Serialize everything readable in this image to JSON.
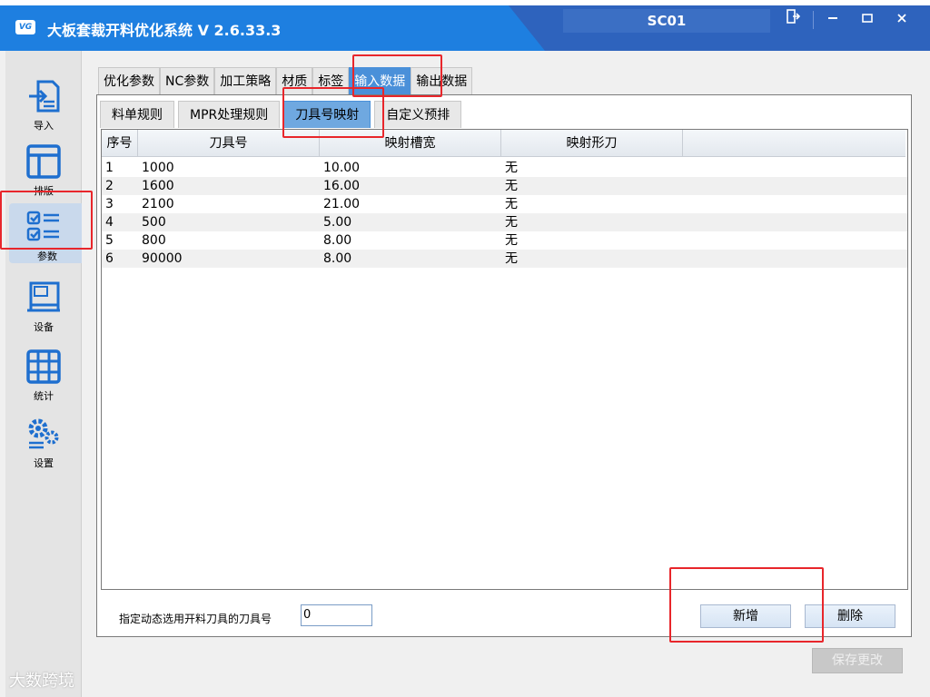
{
  "app": {
    "logo_text": "VG",
    "title": "大板套裁开料优化系统  V 2.6.33.3",
    "station": "SC01"
  },
  "sidebar": {
    "items": [
      {
        "label": "导入",
        "icon": "import-icon"
      },
      {
        "label": "排版",
        "icon": "layout-icon"
      },
      {
        "label": "参数",
        "icon": "checklist-icon",
        "active": true
      },
      {
        "label": "设备",
        "icon": "machine-icon"
      },
      {
        "label": "统计",
        "icon": "table-icon"
      },
      {
        "label": "设置",
        "icon": "gears-icon"
      }
    ]
  },
  "tabs_top": [
    "优化参数",
    "NC参数",
    "加工策略",
    "材质",
    "标签",
    "输入数据",
    "输出数据"
  ],
  "tabs_top_active": "输入数据",
  "tabs_sub": [
    "料单规则",
    "MPR处理规则",
    "刀具号映射",
    "自定义预排"
  ],
  "tabs_sub_active": "刀具号映射",
  "table": {
    "headers": [
      "序号",
      "刀具号",
      "映射槽宽",
      "映射形刀"
    ],
    "rows": [
      [
        "1",
        "1000",
        "10.00",
        "无"
      ],
      [
        "2",
        "1600",
        "16.00",
        "无"
      ],
      [
        "3",
        "2100",
        "21.00",
        "无"
      ],
      [
        "4",
        "500",
        "5.00",
        "无"
      ],
      [
        "5",
        "800",
        "8.00",
        "无"
      ],
      [
        "6",
        "90000",
        "8.00",
        "无"
      ]
    ]
  },
  "footer": {
    "label": "指定动态选用开料刀具的刀具号",
    "value": "0",
    "add_label": "新增",
    "delete_label": "删除",
    "save_label": "保存更改"
  },
  "watermark": "大数跨境",
  "colors": {
    "accent": "#1e7fe0",
    "tab_active": "#4a90d9",
    "highlight": "#e8262b"
  }
}
